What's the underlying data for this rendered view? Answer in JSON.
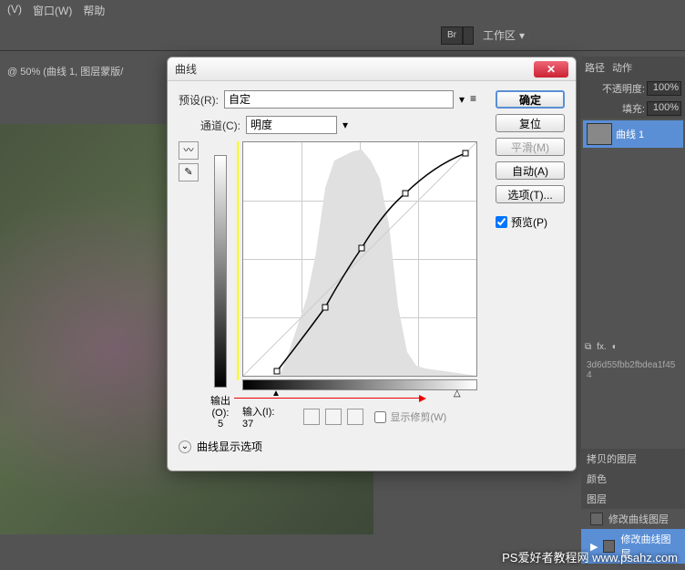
{
  "menu": {
    "m1": "(V)",
    "m2": "窗口(W)",
    "m3": "帮助"
  },
  "workspace_label": "工作区",
  "br_label": "Br",
  "doc_title": "@ 50% (曲线 1, 图层蒙版/",
  "dialog": {
    "title": "曲线",
    "preset_label": "预设(R):",
    "preset_value": "自定",
    "channel_label": "通道(C):",
    "channel_value": "明度",
    "output_label": "输出(O):",
    "output_value": "5",
    "input_label": "输入(I):",
    "input_value": "37",
    "show_clip": "显示修剪(W)",
    "display_options": "曲线显示选项",
    "ok": "确定",
    "reset": "复位",
    "smooth": "平滑(M)",
    "auto": "自动(A)",
    "options": "选项(T)...",
    "preview": "预览(P)"
  },
  "panels": {
    "tab_path": "路径",
    "tab_actions": "动作",
    "opacity_label": "不透明度:",
    "opacity_value": "100%",
    "fill_label": "填充:",
    "fill_value": "100%",
    "layer_name": "曲线 1",
    "hash": "3d6d55fbb2fbdea1f454",
    "copy_layer": "拷贝的图层",
    "color_layer": "颜色",
    "layer_plain": "图层",
    "mod_curve1": "修改曲线图层",
    "mod_curve2": "修改曲线图层"
  },
  "watermark": "PS爱好者教程网 www.psahz.com",
  "chart_data": {
    "type": "line",
    "title": "曲线 (Curves - Lightness Channel)",
    "xlabel": "输入 (Input)",
    "ylabel": "输出 (Output)",
    "xlim": [
      0,
      255
    ],
    "ylim": [
      0,
      255
    ],
    "control_points": [
      {
        "x": 37,
        "y": 5
      },
      {
        "x": 90,
        "y": 75
      },
      {
        "x": 130,
        "y": 140
      },
      {
        "x": 178,
        "y": 200
      },
      {
        "x": 244,
        "y": 244
      }
    ],
    "black_point": 37,
    "white_point": 244,
    "histogram_peaks_approx": [
      {
        "x_range": [
          40,
          90
        ],
        "density": 0.3
      },
      {
        "x_range": [
          90,
          170
        ],
        "density": 0.95
      },
      {
        "x_range": [
          170,
          255
        ],
        "density": 0.02
      }
    ]
  }
}
